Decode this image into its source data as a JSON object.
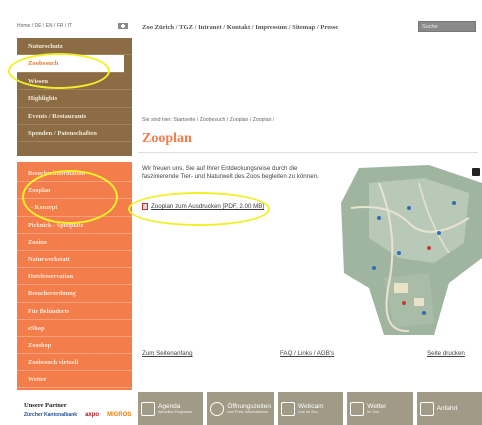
{
  "language_bar": {
    "text": "Home / DE / EN / FR / IT"
  },
  "top_nav": {
    "links": "Zoo Zürich / TGZ / Intranet / Kontakt / Impressum / Sitemap / Presse",
    "search_placeholder": "Suche"
  },
  "sidebar_primary": {
    "items": [
      {
        "label": "Naturschutz"
      },
      {
        "label": "Zoobesuch",
        "active": true
      },
      {
        "label": "Wissen"
      },
      {
        "label": "Highlights"
      },
      {
        "label": "Events / Restaurants"
      },
      {
        "label": "Spenden / Patenschaften"
      }
    ]
  },
  "sidebar_secondary": {
    "items": [
      {
        "label": "Besucherinformation"
      },
      {
        "label": "Zooplan"
      },
      {
        "label": "- Konzept"
      },
      {
        "label": "Picknick - Spielplatz"
      },
      {
        "label": "Zooino"
      },
      {
        "label": "Naturwerkstatt"
      },
      {
        "label": "Hotelreservation"
      },
      {
        "label": "Besucherordnung"
      },
      {
        "label": "Für Behinderte"
      },
      {
        "label": "eShop"
      },
      {
        "label": "Zooshop"
      },
      {
        "label": "Zoobesuch virtuell"
      },
      {
        "label": "Wetter"
      }
    ]
  },
  "partners": {
    "title": "Unsere Partner",
    "items": [
      "Zürcher Kantonalbank",
      "axpo",
      "MIGROS"
    ]
  },
  "main": {
    "breadcrumb": "Sie sind hier:  Startseite / Zoobesuch / Zooplan / Zooplan /",
    "title": "Zooplan",
    "intro": "Wir freuen uns, Sie auf Ihrer Entdeckungsreise durch die faszinierende Tier- und Naturwelt des Zoos begleiten zu können.",
    "pdf_link": "Zooplan zum Ausdrucken  [PDF, 2.00 MB]"
  },
  "bottom_links": {
    "top": "Zum Seitenanfang",
    "faq": "FAQ / Links / AGB's",
    "print": "Seite drucken"
  },
  "quicklinks": [
    {
      "title": "Agenda",
      "sub": "Aktuelles Programm",
      "icon": "calendar-icon"
    },
    {
      "title": "Öffnungszeiten",
      "sub": "und Preis-Informationen",
      "icon": "clock-icon"
    },
    {
      "title": "Webcam",
      "sub": "Live im Zoo",
      "icon": "camera-icon"
    },
    {
      "title": "Wetter",
      "sub": "im Zoo",
      "icon": "weather-icon"
    },
    {
      "title": "Anfahrt",
      "sub": "",
      "icon": "train-icon"
    }
  ],
  "colors": {
    "brown_nav": "#8c6c44",
    "orange_nav": "#f47d4c",
    "title": "#f47d4c",
    "annotation": "#f2ef2a"
  }
}
